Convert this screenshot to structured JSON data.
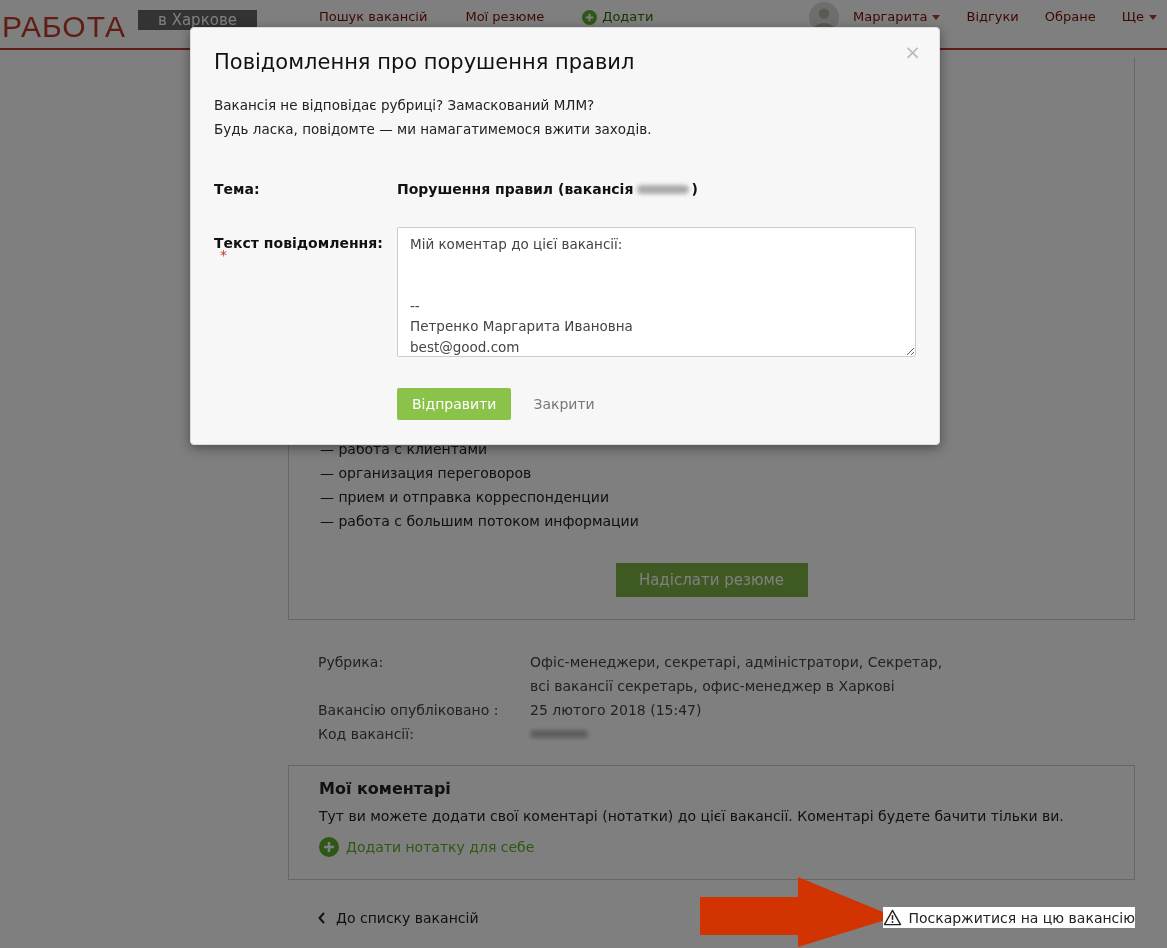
{
  "header": {
    "logo": "РАБОТА",
    "city": "в Харкове",
    "nav": [
      {
        "label": "Пошук вакансій",
        "kind": "link"
      },
      {
        "label": "Мої резюме",
        "kind": "link"
      },
      {
        "label": "Додати",
        "kind": "add"
      }
    ],
    "user": {
      "name": "Маргарита"
    },
    "right_nav": [
      {
        "label": "Відгуки",
        "dropdown": false
      },
      {
        "label": "Обране",
        "dropdown": false
      },
      {
        "label": "Ще",
        "dropdown": true
      }
    ]
  },
  "duties": [
    "— работа с клиентами",
    "— организация переговоров",
    "— прием и отправка корреспонденции",
    "— работа с большим потоком информации"
  ],
  "apply_button": "Надіслати резюме",
  "details": [
    {
      "label": "Рубрика:",
      "lines": [
        "Офіс-менеджери, секретарі, адміністратори,  Секретар,",
        "всі вакансії секретарь, офис-менеджер в Харкові"
      ],
      "blurred": false
    },
    {
      "label": "Вакансію опубліковано :",
      "lines": [
        "25 лютого 2018 (15:47)"
      ],
      "blurred": false
    },
    {
      "label": "Код вакансії:",
      "blurred": true
    }
  ],
  "comments": {
    "title": "Мої коментарі",
    "text": "Тут ви можете додати свої коментарі (нотатки) до цієї вакансії. Коментарі будете бачити тільки ви.",
    "add_link": "Додати нотатку для себе"
  },
  "footer": {
    "back": "До списку вакансій",
    "complain": "Поскаржитися на цю вакансію"
  },
  "dialog": {
    "title": "Повідомлення про порушення правил",
    "close": "×",
    "intro": [
      "Вакансія не відповідає рубриці? Замаскований МЛМ?",
      "Будь ласка, повідомте — ми намагатимемося вжити заходів."
    ],
    "subject_label": "Тема:",
    "subject": "Порушення правил (вакансія",
    "subject_end": ")",
    "message_label": "Текст повідомлення:",
    "required": true,
    "required_mark": "*",
    "message": "Мій коментар до цієї вакансії:\n\n\n--\nПетренко Маргарита Ивановна\nbest@good.com",
    "buttons": [
      {
        "label": "Відправити",
        "kind": "primary"
      },
      {
        "label": "Закрити",
        "kind": "link"
      }
    ]
  }
}
